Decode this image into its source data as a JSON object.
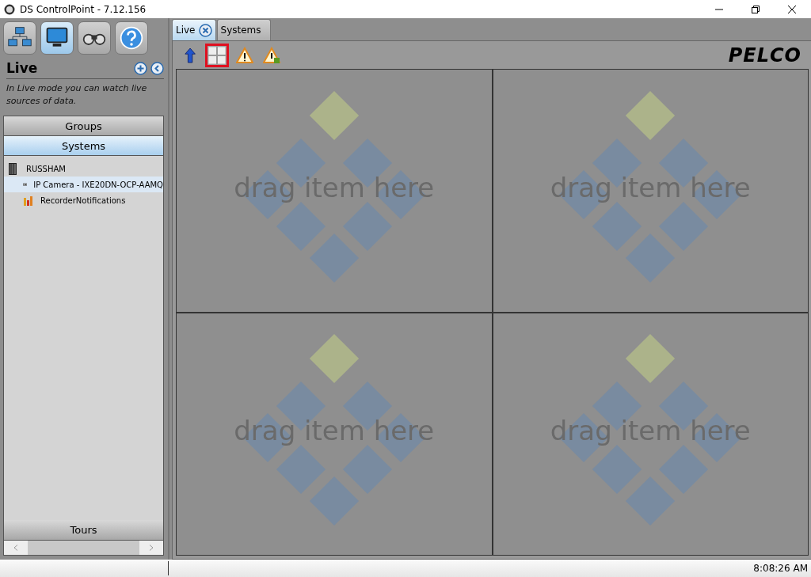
{
  "window": {
    "title": "DS ControlPoint - 7.12.156"
  },
  "nav_buttons": [
    {
      "kind": "network",
      "selected": false
    },
    {
      "kind": "monitor",
      "selected": true
    },
    {
      "kind": "binoculars",
      "selected": false
    },
    {
      "kind": "help",
      "selected": false
    }
  ],
  "panel": {
    "title": "Live",
    "description": "In Live mode you can watch live sources of data."
  },
  "accordion": {
    "sections": [
      {
        "label": "Groups",
        "selected": false
      },
      {
        "label": "Systems",
        "selected": true
      }
    ],
    "tree": [
      {
        "label": "RUSSHAM",
        "kind": "server",
        "selected": false,
        "children": [
          {
            "label": "IP Camera - IXE20DN-OCP-AAMQ",
            "kind": "camera",
            "selected": true
          },
          {
            "label": "RecorderNotifications",
            "kind": "chart",
            "selected": false
          }
        ]
      }
    ],
    "footer": "Tours"
  },
  "tabs": [
    {
      "label": "Live",
      "selected": true,
      "closable": true
    },
    {
      "label": "Systems",
      "selected": false,
      "closable": false
    }
  ],
  "toolbar": [
    {
      "kind": "back",
      "selected": false
    },
    {
      "kind": "layout",
      "selected": true
    },
    {
      "kind": "alert",
      "selected": false
    },
    {
      "kind": "alert-event",
      "selected": false
    }
  ],
  "logo": "PELCO",
  "cells": [
    {
      "text": "drag item here"
    },
    {
      "text": "drag item here"
    },
    {
      "text": "drag item here"
    },
    {
      "text": "drag item here"
    }
  ],
  "status_bar": {
    "time": "8:08:26 AM"
  }
}
